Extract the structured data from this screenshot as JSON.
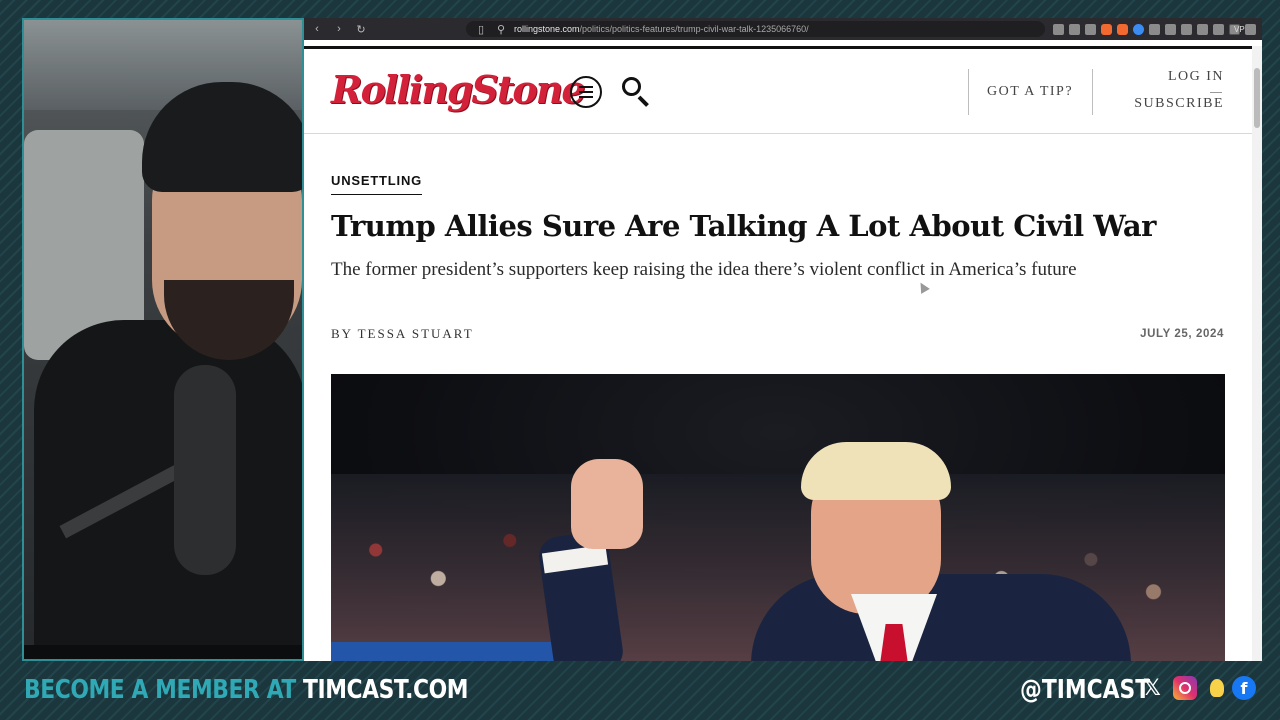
{
  "browser": {
    "url_domain": "rollingstone.com",
    "url_path": "/politics/politics-features/trump-civil-war-talk-1235066760/",
    "vpn_label": "VPN"
  },
  "site": {
    "logo_text": "RollingStone",
    "tip_label": "GOT A TIP?",
    "login_label": "LOG IN",
    "subscribe_label": "SUBSCRIBE"
  },
  "article": {
    "kicker": "UNSETTLING",
    "headline": "Trump Allies Sure Are Talking A Lot About Civil War",
    "dek": "The former president’s supporters keep raising the idea there’s violent conflict in America’s future",
    "byline": "BY TESSA STUART",
    "date": "JULY 25, 2024"
  },
  "overlay": {
    "cta_prefix": "BECOME A MEMBER AT ",
    "cta_domain": "TIMCAST.COM",
    "handle": "@TIMCAST",
    "social_icons": [
      "x-icon",
      "instagram-icon",
      "lightbulb-icon",
      "facebook-icon"
    ]
  },
  "colors": {
    "brand_red": "#d4213a",
    "overlay_teal": "#2fa9b5"
  }
}
